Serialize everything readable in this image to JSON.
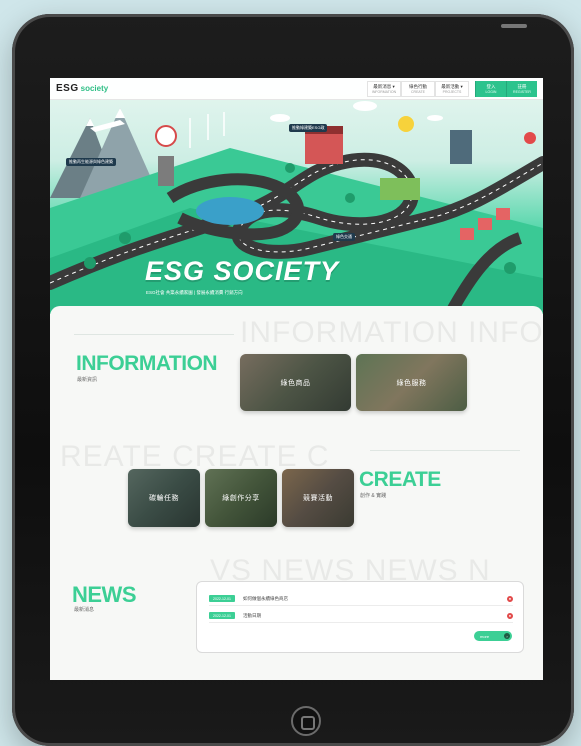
{
  "header": {
    "logo_primary": "ESG",
    "logo_secondary": "society",
    "nav": [
      {
        "label": "最新消息 ▾",
        "sub": "INFORMATION"
      },
      {
        "label": "綠色行動",
        "sub": "CREATE"
      },
      {
        "label": "最新活動 ▾",
        "sub": "PROJECTS"
      }
    ],
    "login": {
      "label": "登入",
      "sub": "LOGIN"
    },
    "register": {
      "label": "註冊",
      "sub": "REGISTER"
    }
  },
  "hero": {
    "title": "ESG SOCIETY",
    "subtitle": "ESG社會 共築永續家園 | 發展永續消費 行銷方向",
    "labels": {
      "left": "推動再生能源與綠色建築",
      "center": "推動綠建築ESG政",
      "lower": "綠色交通"
    }
  },
  "information": {
    "title": "INFORMATION",
    "subtitle": "最新資訊",
    "bg_text": "INFORMATION INFORMATION",
    "cards": [
      {
        "label": "綠色商品"
      },
      {
        "label": "綠色服務"
      }
    ]
  },
  "create": {
    "title": "CREATE",
    "subtitle": "創作 & 實踐",
    "bg_text": "REATE CREATE C",
    "cards": [
      {
        "label": "碳輪任務"
      },
      {
        "label": "綠創作分享"
      },
      {
        "label": "競賽活動"
      }
    ]
  },
  "news": {
    "title": "NEWS",
    "subtitle": "最新消息",
    "bg_text": "VS NEWS NEWS N",
    "items": [
      {
        "tag": "2022-12-01",
        "text": "如何做個永續綠色商店"
      },
      {
        "tag": "2022-12-01",
        "text": "活動日期"
      }
    ],
    "more_label": "more",
    "more_arrow": "›",
    "dot_symbol": "●"
  },
  "colors": {
    "accent": "#3ccf95",
    "dark": "#111111"
  },
  "icons": {
    "home_button": "home-button-icon"
  }
}
